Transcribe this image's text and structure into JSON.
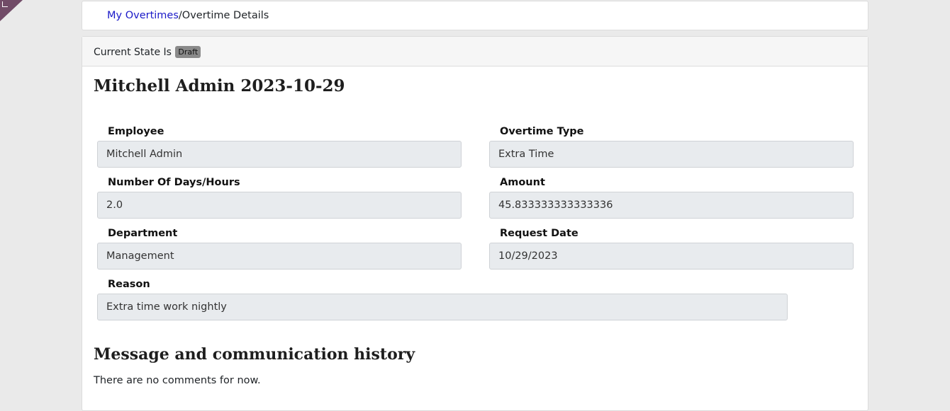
{
  "breadcrumb": {
    "parent": "My Overtimes",
    "separator": "/",
    "current": "Overtime Details"
  },
  "state": {
    "label": "Current State Is",
    "value": "Draft"
  },
  "record": {
    "title": "Mitchell Admin 2023-10-29"
  },
  "fields": {
    "employee": {
      "label": "Employee",
      "value": "Mitchell Admin"
    },
    "overtime_type": {
      "label": "Overtime Type",
      "value": "Extra Time"
    },
    "days_hours": {
      "label": "Number Of Days/Hours",
      "value": "2.0"
    },
    "amount": {
      "label": "Amount",
      "value": "45.833333333333336"
    },
    "department": {
      "label": "Department",
      "value": "Management"
    },
    "request_date": {
      "label": "Request Date",
      "value": "10/29/2023"
    },
    "reason": {
      "label": "Reason",
      "value": "Extra time work nightly"
    }
  },
  "messages": {
    "title": "Message and communication history",
    "empty_text": "There are no comments for now."
  },
  "colors": {
    "brand": "#714b67",
    "link": "#1a19c8",
    "badge": "#8a8a8a",
    "input_bg": "#e8ebee"
  }
}
